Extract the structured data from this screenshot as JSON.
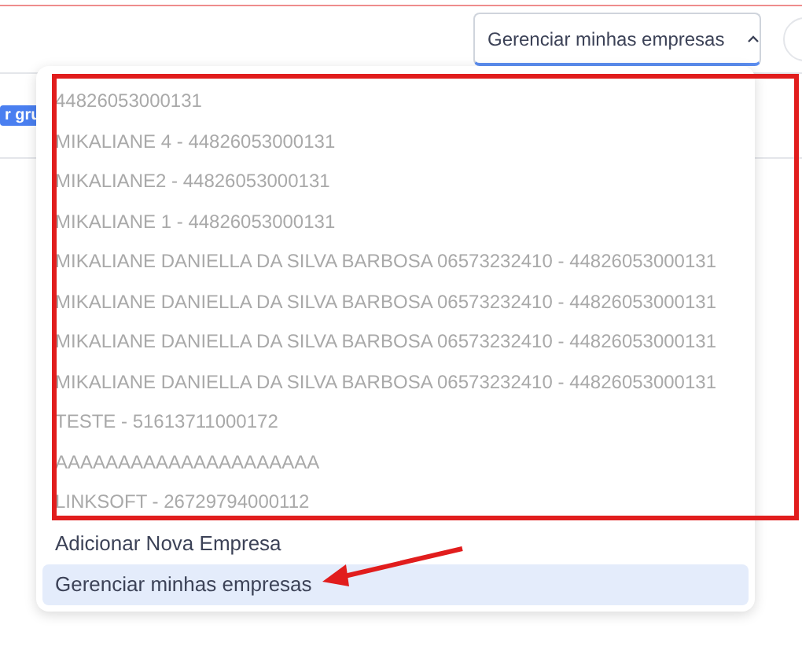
{
  "header": {
    "company_select": {
      "value": "Gerenciar minhas empresas",
      "expanded": true
    }
  },
  "background": {
    "tag": "r gru"
  },
  "menu": {
    "companies": [
      "44826053000131",
      "MIKALIANE 4 - 44826053000131",
      "MIKALIANE2 - 44826053000131",
      "MIKALIANE 1 - 44826053000131",
      "MIKALIANE DANIELLA DA SILVA BARBOSA 06573232410 - 44826053000131",
      "MIKALIANE DANIELLA DA SILVA BARBOSA 06573232410 - 44826053000131",
      "MIKALIANE DANIELLA DA SILVA BARBOSA 06573232410 - 44826053000131",
      "MIKALIANE DANIELLA DA SILVA BARBOSA 06573232410 - 44826053000131",
      "TESTE - 51613711000172",
      "AAAAAAAAAAAAAAAAAAAAA",
      "LINKSOFT - 26729794000112"
    ],
    "actions": [
      {
        "label": "Adicionar Nova Empresa",
        "selected": false
      },
      {
        "label": "Gerenciar minhas empresas",
        "selected": true
      }
    ]
  }
}
